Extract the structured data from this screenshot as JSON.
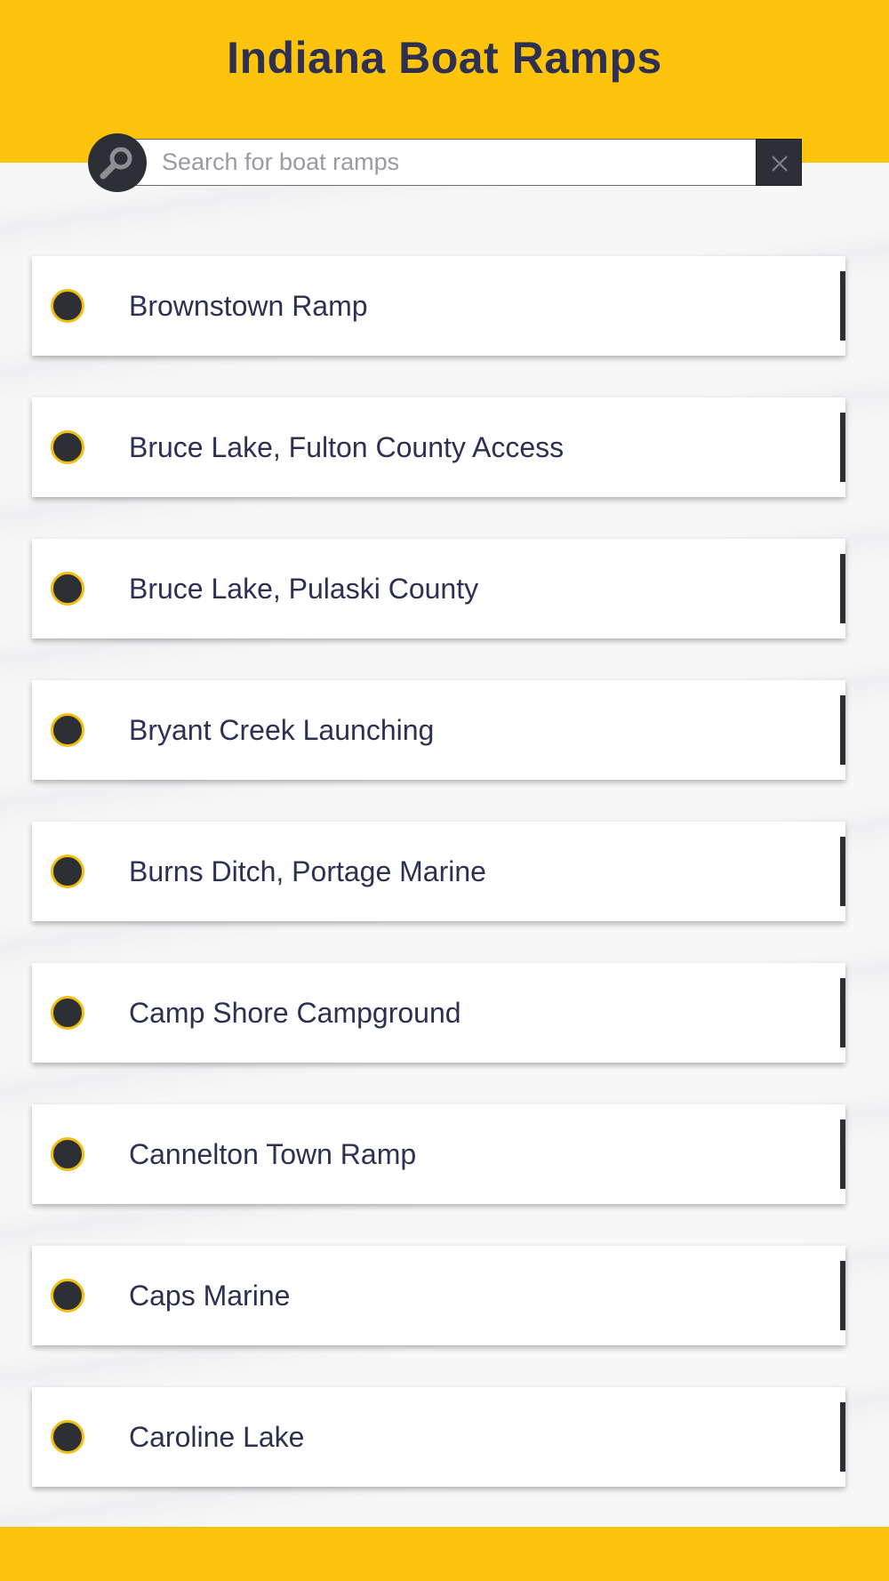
{
  "header": {
    "title": "Indiana Boat Ramps",
    "background_color": "#fec40c"
  },
  "search": {
    "placeholder": "Search for boat ramps",
    "value": "",
    "search_icon": "search-icon",
    "clear_icon": "close-icon"
  },
  "ramps": [
    {
      "name": "Brownstown Ramp"
    },
    {
      "name": "Bruce Lake, Fulton County Access"
    },
    {
      "name": "Bruce Lake, Pulaski County"
    },
    {
      "name": "Bryant Creek Launching"
    },
    {
      "name": "Burns Ditch, Portage Marine"
    },
    {
      "name": "Camp Shore Campground"
    },
    {
      "name": "Cannelton Town Ramp"
    },
    {
      "name": "Caps Marine"
    },
    {
      "name": "Caroline Lake"
    }
  ],
  "colors": {
    "accent": "#fec40c",
    "dark": "#2c2f33",
    "text": "#2d3050"
  }
}
